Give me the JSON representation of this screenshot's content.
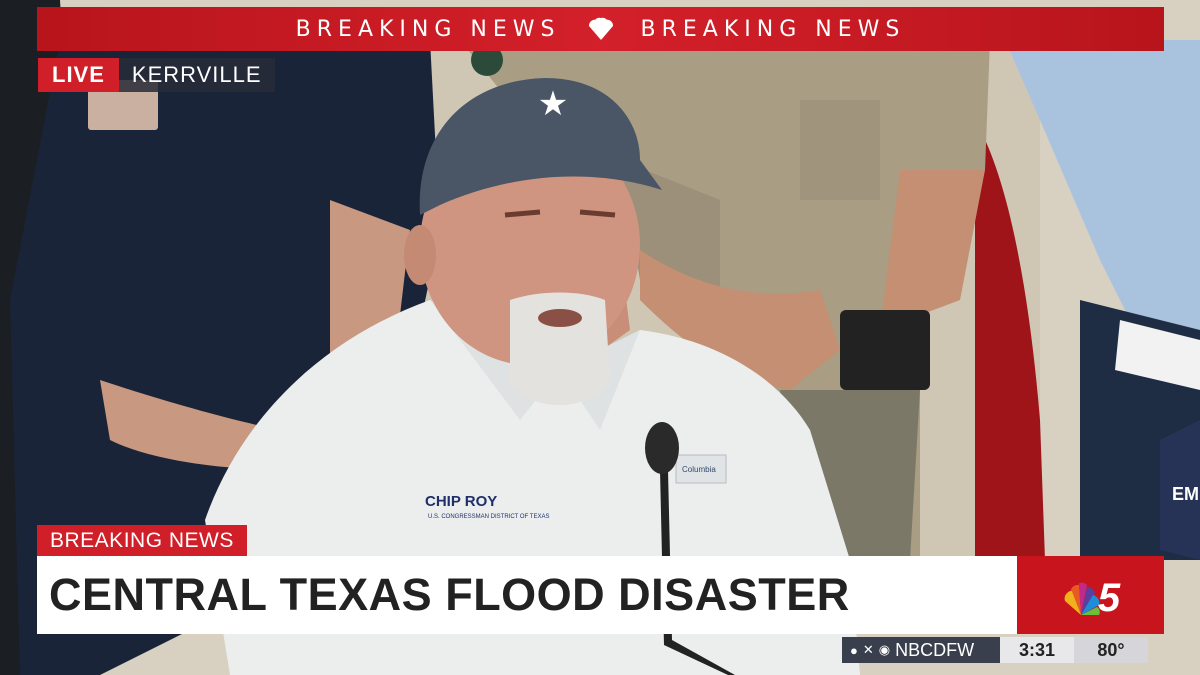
{
  "top_banner": {
    "left_text": "BREAKING NEWS",
    "right_text": "BREAKING NEWS"
  },
  "live_tag": {
    "live_label": "LIVE",
    "location": "KERRVILLE"
  },
  "lower_third": {
    "tag": "BREAKING NEWS",
    "headline": "CENTRAL TEXAS FLOOD DISASTER"
  },
  "ticker": {
    "social_handle": "NBCDFW",
    "time": "3:31",
    "temperature": "80°"
  },
  "scene": {
    "cap_star": "★",
    "shirt_logo": "CHIP ROY",
    "shirt_logo_sub": "U.S. CONGRESSMAN DISTRICT OF TEXAS",
    "shirt_brand": "Columbia"
  },
  "colors": {
    "brand_red": "#d01f28",
    "headline_text": "#222222"
  },
  "icons": [
    "nbc-peacock-icon",
    "facebook-icon",
    "x-icon",
    "instagram-icon",
    "channel-5-logo-icon"
  ]
}
